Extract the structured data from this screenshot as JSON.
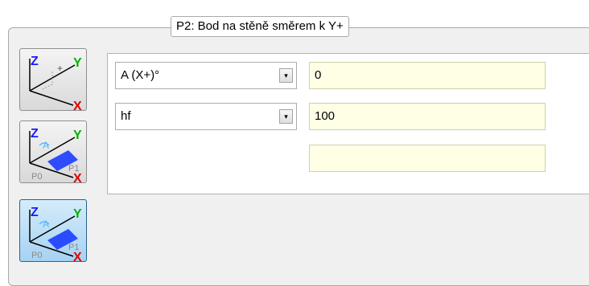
{
  "panel": {
    "title": "P2: Bod na stěně směrem k Y+"
  },
  "axis_labels": {
    "z": "Z",
    "y": "Y",
    "x": "X",
    "p0": "P0",
    "p1": "P1",
    "angle": "A"
  },
  "colors": {
    "z": "#1a1aff",
    "y": "#00b000",
    "x": "#e00000",
    "plane": "#1c3cff",
    "angle": "#55b7ff",
    "point": "#8a8a8a"
  },
  "buttons": [
    {
      "name": "point-mode",
      "active": false
    },
    {
      "name": "plane-angle-mode",
      "active": false
    },
    {
      "name": "plane-angle-mode-alt",
      "active": true
    }
  ],
  "params": [
    {
      "label": "A (X+)°",
      "value": "0"
    },
    {
      "label": "hf",
      "value": "100"
    }
  ],
  "extra_field": {
    "value": ""
  },
  "dropdown_glyph": "▾"
}
